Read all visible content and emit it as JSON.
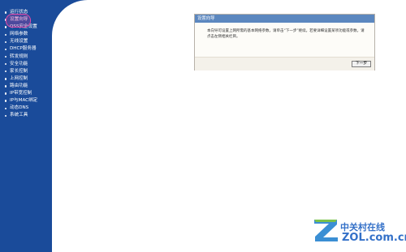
{
  "sidebar": {
    "items": [
      {
        "label": "运行状态"
      },
      {
        "label": "设置向导",
        "active": true
      },
      {
        "label": "QSS安全设置"
      },
      {
        "label": "网络参数"
      },
      {
        "label": "无线设置"
      },
      {
        "label": "DHCP服务器"
      },
      {
        "label": "转发规则"
      },
      {
        "label": "安全功能"
      },
      {
        "label": "家长控制"
      },
      {
        "label": "上网控制"
      },
      {
        "label": "路由功能"
      },
      {
        "label": "IP带宽控制"
      },
      {
        "label": "IP与MAC绑定"
      },
      {
        "label": "动态DNS"
      },
      {
        "label": "系统工具"
      }
    ]
  },
  "wizard": {
    "title": "设置向导",
    "description": "本向导可设置上网所需的基本网络参数，请单击“下一步”继续。若要详细设置某项功能或参数，请点击左侧相关栏目。",
    "next_label": "下一步"
  },
  "watermark": {
    "brand_cn": "中关村在线",
    "brand_en": "ZOL.com.cn"
  },
  "colors": {
    "sidebar_bg": "#1a4b9a",
    "panel_header": "#5b87bf",
    "highlight": "#e34aa8",
    "watermark": "#3370c8"
  }
}
